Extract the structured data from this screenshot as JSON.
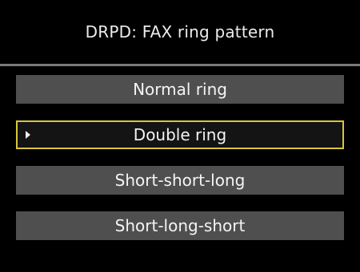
{
  "header": {
    "title": "DRPD: FAX ring pattern"
  },
  "menu": {
    "items": [
      {
        "label": "Normal ring",
        "selected": false
      },
      {
        "label": "Double ring",
        "selected": true
      },
      {
        "label": "Short-short-long",
        "selected": false
      },
      {
        "label": "Short-long-short",
        "selected": false
      }
    ],
    "cursor_icon": "triangle-right-icon"
  },
  "colors": {
    "background": "#000000",
    "item_background": "#4f4f4f",
    "selection_border": "#d8c83a"
  }
}
